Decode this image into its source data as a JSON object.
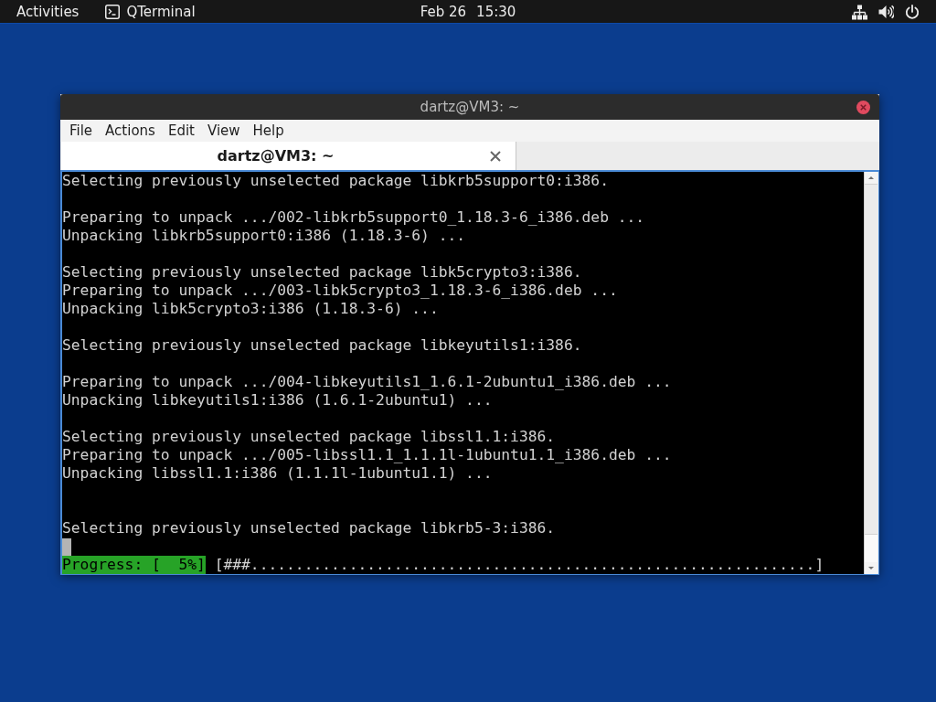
{
  "top_bar": {
    "activities": "Activities",
    "app": "QTerminal",
    "date": "Feb 26",
    "time": "15:30"
  },
  "window": {
    "title": "dartz@VM3: ~",
    "menu": [
      "File",
      "Actions",
      "Edit",
      "View",
      "Help"
    ],
    "tabs": [
      {
        "label": "dartz@VM3: ~",
        "selected": true
      }
    ],
    "terminal": {
      "lines": [
        {
          "kind": "text",
          "text": "Selecting previously unselected package libkrb5support0:i386."
        },
        {
          "kind": "blank"
        },
        {
          "kind": "text",
          "text": "Preparing to unpack .../002-libkrb5support0_1.18.3-6_i386.deb ..."
        },
        {
          "kind": "text",
          "text": "Unpacking libkrb5support0:i386 (1.18.3-6) ..."
        },
        {
          "kind": "blank"
        },
        {
          "kind": "text",
          "text": "Selecting previously unselected package libk5crypto3:i386."
        },
        {
          "kind": "text",
          "text": "Preparing to unpack .../003-libk5crypto3_1.18.3-6_i386.deb ..."
        },
        {
          "kind": "text",
          "text": "Unpacking libk5crypto3:i386 (1.18.3-6) ..."
        },
        {
          "kind": "blank"
        },
        {
          "kind": "text",
          "text": "Selecting previously unselected package libkeyutils1:i386."
        },
        {
          "kind": "blank"
        },
        {
          "kind": "text",
          "text": "Preparing to unpack .../004-libkeyutils1_1.6.1-2ubuntu1_i386.deb ..."
        },
        {
          "kind": "text",
          "text": "Unpacking libkeyutils1:i386 (1.6.1-2ubuntu1) ..."
        },
        {
          "kind": "blank"
        },
        {
          "kind": "text",
          "text": "Selecting previously unselected package libssl1.1:i386."
        },
        {
          "kind": "text",
          "text": "Preparing to unpack .../005-libssl1.1_1.1.1l-1ubuntu1.1_i386.deb ..."
        },
        {
          "kind": "text",
          "text": "Unpacking libssl1.1:i386 (1.1.1l-1ubuntu1.1) ..."
        },
        {
          "kind": "blank"
        },
        {
          "kind": "blank"
        },
        {
          "kind": "text",
          "text": "Selecting previously unselected package libkrb5-3:i386."
        },
        {
          "kind": "cursor"
        },
        {
          "kind": "progress",
          "label": "Progress: [  5%]",
          "bar": "[###...............................................................]"
        }
      ]
    }
  }
}
